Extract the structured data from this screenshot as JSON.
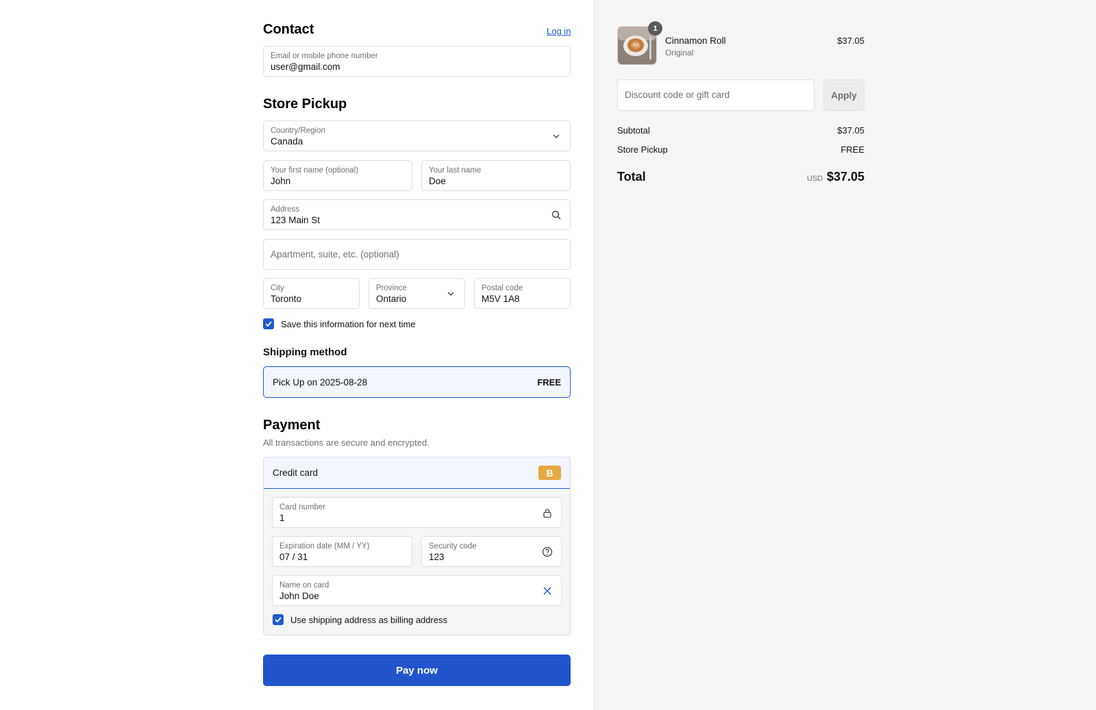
{
  "contact": {
    "heading": "Contact",
    "login_link": "Log in",
    "email": {
      "label": "Email or mobile phone number",
      "value": "user@gmail.com"
    }
  },
  "pickup": {
    "heading": "Store Pickup",
    "country": {
      "label": "Country/Region",
      "value": "Canada"
    },
    "first_name": {
      "label": "Your first name (optional)",
      "value": "John"
    },
    "last_name": {
      "label": "Your last name",
      "value": "Doe"
    },
    "address": {
      "label": "Address",
      "value": "123 Main St"
    },
    "apartment": {
      "placeholder": "Apartment, suite, etc. (optional)"
    },
    "city": {
      "label": "City",
      "value": "Toronto"
    },
    "province": {
      "label": "Province",
      "value": "Ontario"
    },
    "postal": {
      "label": "Postal code",
      "value": "M5V 1A8"
    },
    "save_info_label": "Save this information for next time"
  },
  "shipping": {
    "heading": "Shipping method",
    "option_name": "Pick Up on 2025-08-28",
    "option_price": "FREE"
  },
  "payment": {
    "heading": "Payment",
    "subtitle": "All transactions are secure and encrypted.",
    "method_name": "Credit card",
    "method_badge": "B",
    "card_number": {
      "label": "Card number",
      "value": "1"
    },
    "expiry": {
      "label": "Expiration date (MM / YY)",
      "value": "07 / 31"
    },
    "security": {
      "label": "Security code",
      "value": "123"
    },
    "name_on_card": {
      "label": "Name on card",
      "value": "John Doe"
    },
    "billing_label": "Use shipping address as billing address",
    "pay_button": "Pay now"
  },
  "summary": {
    "item": {
      "name": "Cinnamon Roll",
      "variant": "Original",
      "price": "$37.05",
      "quantity": "1"
    },
    "discount_placeholder": "Discount code or gift card",
    "apply_label": "Apply",
    "subtotal_label": "Subtotal",
    "subtotal_value": "$37.05",
    "pickup_label": "Store Pickup",
    "pickup_value": "FREE",
    "total_label": "Total",
    "currency": "USD",
    "total_value": "$37.05"
  },
  "colors": {
    "accent": "#2255cc",
    "badge": "#e4a944",
    "sidebar_bg": "#f5f5f5"
  }
}
